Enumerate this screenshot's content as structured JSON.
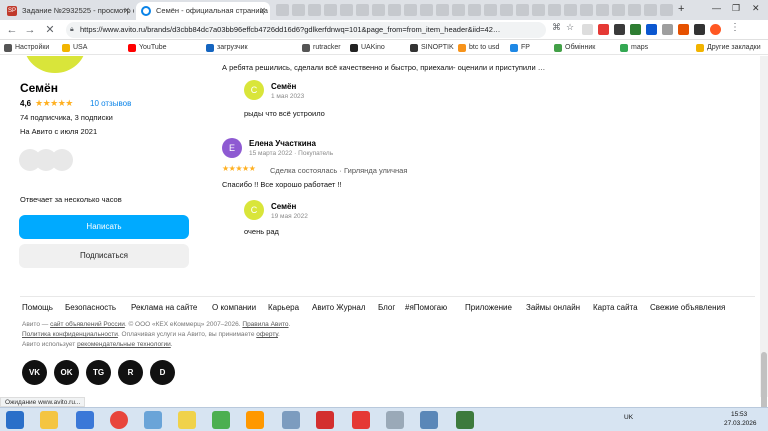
{
  "browser": {
    "tabs": [
      {
        "label": "Задание №2932525 - просмотр с",
        "favicon_text": "SP",
        "active": false
      },
      {
        "label": "Семён - официальная страница п",
        "active": true
      }
    ],
    "new_tab": "+",
    "url": "https://www.avito.ru/brands/d3cbb84dc7a03bb96effcb4726dd16d6?gdlkerfdnwq=101&page_from=from_item_header&iid=42…",
    "bookmarks": [
      "Настройки",
      "USA",
      "YouTube",
      "загрузчик",
      "rutracker",
      "UAKino",
      "SINOPTIK",
      "btc to usd",
      "FP",
      "Обмінник",
      "maps"
    ],
    "other_bookmarks": "Другие закладки",
    "status": "Ожидание www.avito.ru..."
  },
  "seller": {
    "name": "Семён",
    "rating": "4,6",
    "stars": "★★★★★",
    "reviews_link": "10 отзывов",
    "subs": "74 подписчика, 3 подписки",
    "since": "На Авито с июля 2021",
    "reply_time": "Отвечает за несколько часов",
    "write_btn": "Написать",
    "subscribe_btn": "Подписаться"
  },
  "reviews": {
    "top_text": "А ребята решились, сделали всё качественно и быстро, приехали- оценили и приступили …",
    "reply1": {
      "initial": "С",
      "name": "Семён",
      "date": "1 мая 2023",
      "text": "рыды что всё устроило"
    },
    "review2": {
      "initial": "Е",
      "name": "Елена Участкина",
      "date": "15 марта 2022 · Покупатель",
      "stars": "★★★★★",
      "meta": "Сделка состоялась · Гирлянда уличная",
      "text": "Спасибо !! Все хорошо работает !!"
    },
    "reply2": {
      "initial": "С",
      "name": "Семён",
      "date": "19 мая 2022",
      "text": "очень рад"
    }
  },
  "footer": {
    "links": [
      "Помощь",
      "Безопасность",
      "Реклама на сайте",
      "О компании",
      "Карьера",
      "Авито Журнал",
      "Блог",
      "#яПомогаю",
      "Приложение",
      "Займы онлайн",
      "Карта сайта",
      "Свежие объявления"
    ],
    "legal1_a": "Авито — ",
    "legal1_link": "сайт объявлений России",
    "legal1_b": ". © ООО «КЕХ еКоммерц» 2007–2026. ",
    "legal1_link2": "Правила Авито",
    "legal1_c": ".",
    "legal2_link": "Политика конфиденциальности",
    "legal2_b": ". Оплачивая услуги на Авито, вы принимаете ",
    "legal2_link2": "оферту",
    "legal2_c": ".",
    "legal3_a": "Авито использует ",
    "legal3_link": "рекомендательные технологии",
    "legal3_c": ".",
    "social": [
      "VK",
      "OK",
      "TG",
      "R",
      "D"
    ]
  },
  "taskbar": {
    "lang": "UK",
    "time": "15:53",
    "date": "27.03.2026"
  },
  "colors": {
    "avito_blue": "#00aaff",
    "star": "#ffb021",
    "avatar_semen": "#d9e53a",
    "avatar_elena": "#8e5ad2"
  }
}
